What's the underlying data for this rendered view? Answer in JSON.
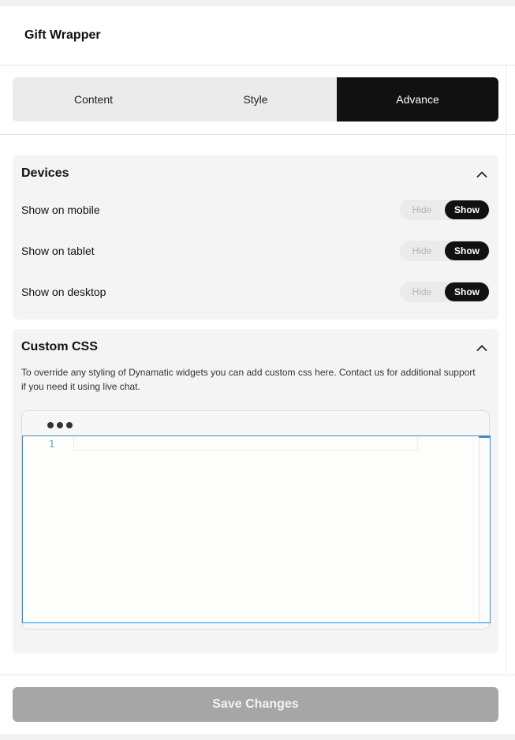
{
  "header": {
    "title": "Gift Wrapper"
  },
  "tabs": [
    {
      "label": "Content",
      "active": false
    },
    {
      "label": "Style",
      "active": false
    },
    {
      "label": "Advance",
      "active": true
    }
  ],
  "devices": {
    "title": "Devices",
    "chevron": "chevron-up-icon",
    "rows": [
      {
        "label": "Show on mobile",
        "hide_label": "Hide",
        "show_label": "Show",
        "selected": "Show"
      },
      {
        "label": "Show on tablet",
        "hide_label": "Hide",
        "show_label": "Show",
        "selected": "Show"
      },
      {
        "label": "Show on desktop",
        "hide_label": "Hide",
        "show_label": "Show",
        "selected": "Show"
      }
    ]
  },
  "custom_css": {
    "title": "Custom CSS",
    "chevron": "chevron-up-icon",
    "description": "To override any styling of Dynamatic widgets you can add custom css here. Contact us for additional support if you need it using live chat.",
    "editor": {
      "line_number": "1",
      "content": ""
    }
  },
  "footer": {
    "save_label": "Save Changes"
  },
  "colors": {
    "active_tab": "#111111",
    "save_disabled": "#a6a6a6",
    "editor_focus": "#2f8fd1"
  }
}
